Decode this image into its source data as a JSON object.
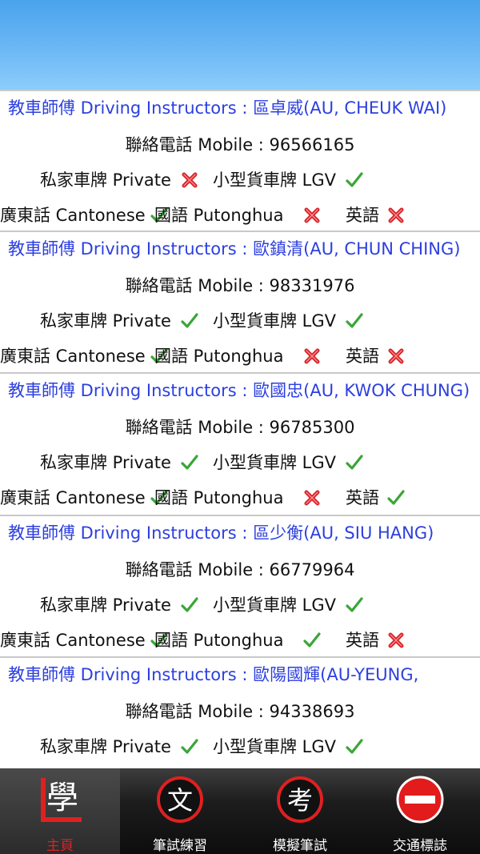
{
  "header": {},
  "labels": {
    "instructor_prefix": "教車師傅 Driving Instructors : ",
    "mobile_prefix": "聯絡電話 Mobile : ",
    "private": "私家車牌 Private",
    "lgv": "小型貨車牌 LGV",
    "cantonese": "廣東話 Cantonese",
    "putonghua": "國語 Putonghua",
    "english": "英語"
  },
  "colors": {
    "link": "#2c3fe0",
    "check": "#3aa637",
    "cross": "#d8262c",
    "active_tab": "#e02020"
  },
  "instructors": [
    {
      "name": "區卓威(AU, CHEUK WAI)",
      "mobile": "96566165",
      "private": false,
      "lgv": true,
      "cantonese": true,
      "putonghua": false,
      "english": false
    },
    {
      "name": "歐鎮清(AU, CHUN CHING)",
      "mobile": "98331976",
      "private": true,
      "lgv": true,
      "cantonese": true,
      "putonghua": false,
      "english": false
    },
    {
      "name": "歐國忠(AU, KWOK CHUNG)",
      "mobile": "96785300",
      "private": true,
      "lgv": true,
      "cantonese": true,
      "putonghua": false,
      "english": true
    },
    {
      "name": "區少衡(AU, SIU HANG)",
      "mobile": "66779964",
      "private": true,
      "lgv": true,
      "cantonese": true,
      "putonghua": true,
      "english": false
    },
    {
      "name": "歐陽國輝(AU-YEUNG,",
      "mobile": "94338693",
      "private": true,
      "lgv": true,
      "cantonese": null,
      "putonghua": null,
      "english": null
    }
  ],
  "tabs": [
    {
      "label": "主頁",
      "icon_text": "學",
      "icon": "learn-icon",
      "active": true
    },
    {
      "label": "筆試練習",
      "icon_text": "文",
      "icon": "practice-icon",
      "active": false
    },
    {
      "label": "模擬筆試",
      "icon_text": "考",
      "icon": "exam-icon",
      "active": false
    },
    {
      "label": "交通標誌",
      "icon_text": "",
      "icon": "no-entry-icon",
      "active": false
    }
  ]
}
